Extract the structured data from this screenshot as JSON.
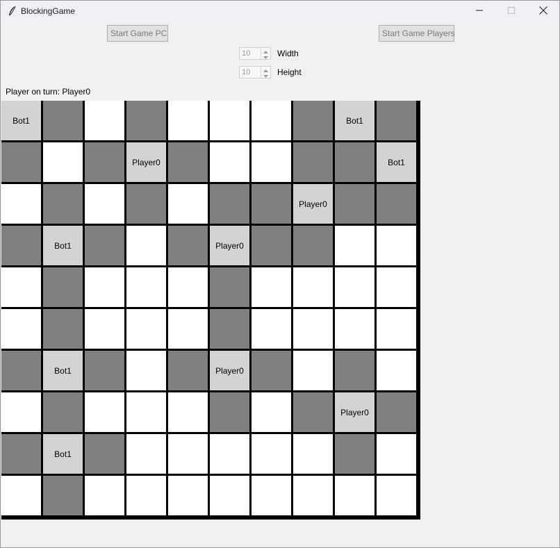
{
  "window": {
    "title": "BlockingGame",
    "icon": "feather-icon"
  },
  "controls": {
    "start_pc_label": "Start Game PC",
    "start_players_label": "Start Game Players",
    "width_value": "10",
    "width_label": "Width",
    "height_value": "10",
    "height_label": "Height"
  },
  "status": {
    "turn_text": "Player on turn: Player0"
  },
  "colors": {
    "white_cell": "#ffffff",
    "blocked_cell": "#808080",
    "occupied_cell": "#d3d3d3",
    "grid_lines": "#000000"
  },
  "board": {
    "legend": {
      "W": "empty",
      "G": "blocked",
      "P": "Player0",
      "B": "Bot1"
    },
    "labels": {
      "P": "Player0",
      "B": "Bot1"
    },
    "rows": [
      [
        "B",
        "G",
        "W",
        "G",
        "W",
        "W",
        "W",
        "G",
        "B",
        "G"
      ],
      [
        "G",
        "W",
        "G",
        "P",
        "G",
        "W",
        "W",
        "G",
        "G",
        "B"
      ],
      [
        "W",
        "G",
        "W",
        "G",
        "W",
        "G",
        "G",
        "P",
        "G",
        "G"
      ],
      [
        "G",
        "B",
        "G",
        "W",
        "G",
        "P",
        "G",
        "G",
        "W",
        "W"
      ],
      [
        "W",
        "G",
        "W",
        "W",
        "W",
        "G",
        "W",
        "W",
        "W",
        "W"
      ],
      [
        "W",
        "G",
        "W",
        "W",
        "W",
        "G",
        "W",
        "W",
        "W",
        "W"
      ],
      [
        "G",
        "B",
        "G",
        "W",
        "G",
        "P",
        "G",
        "W",
        "G",
        "W"
      ],
      [
        "W",
        "G",
        "W",
        "W",
        "W",
        "G",
        "W",
        "G",
        "P",
        "G"
      ],
      [
        "G",
        "B",
        "G",
        "W",
        "W",
        "W",
        "W",
        "W",
        "G",
        "W"
      ],
      [
        "W",
        "G",
        "W",
        "W",
        "W",
        "W",
        "W",
        "W",
        "W",
        "W"
      ]
    ]
  }
}
